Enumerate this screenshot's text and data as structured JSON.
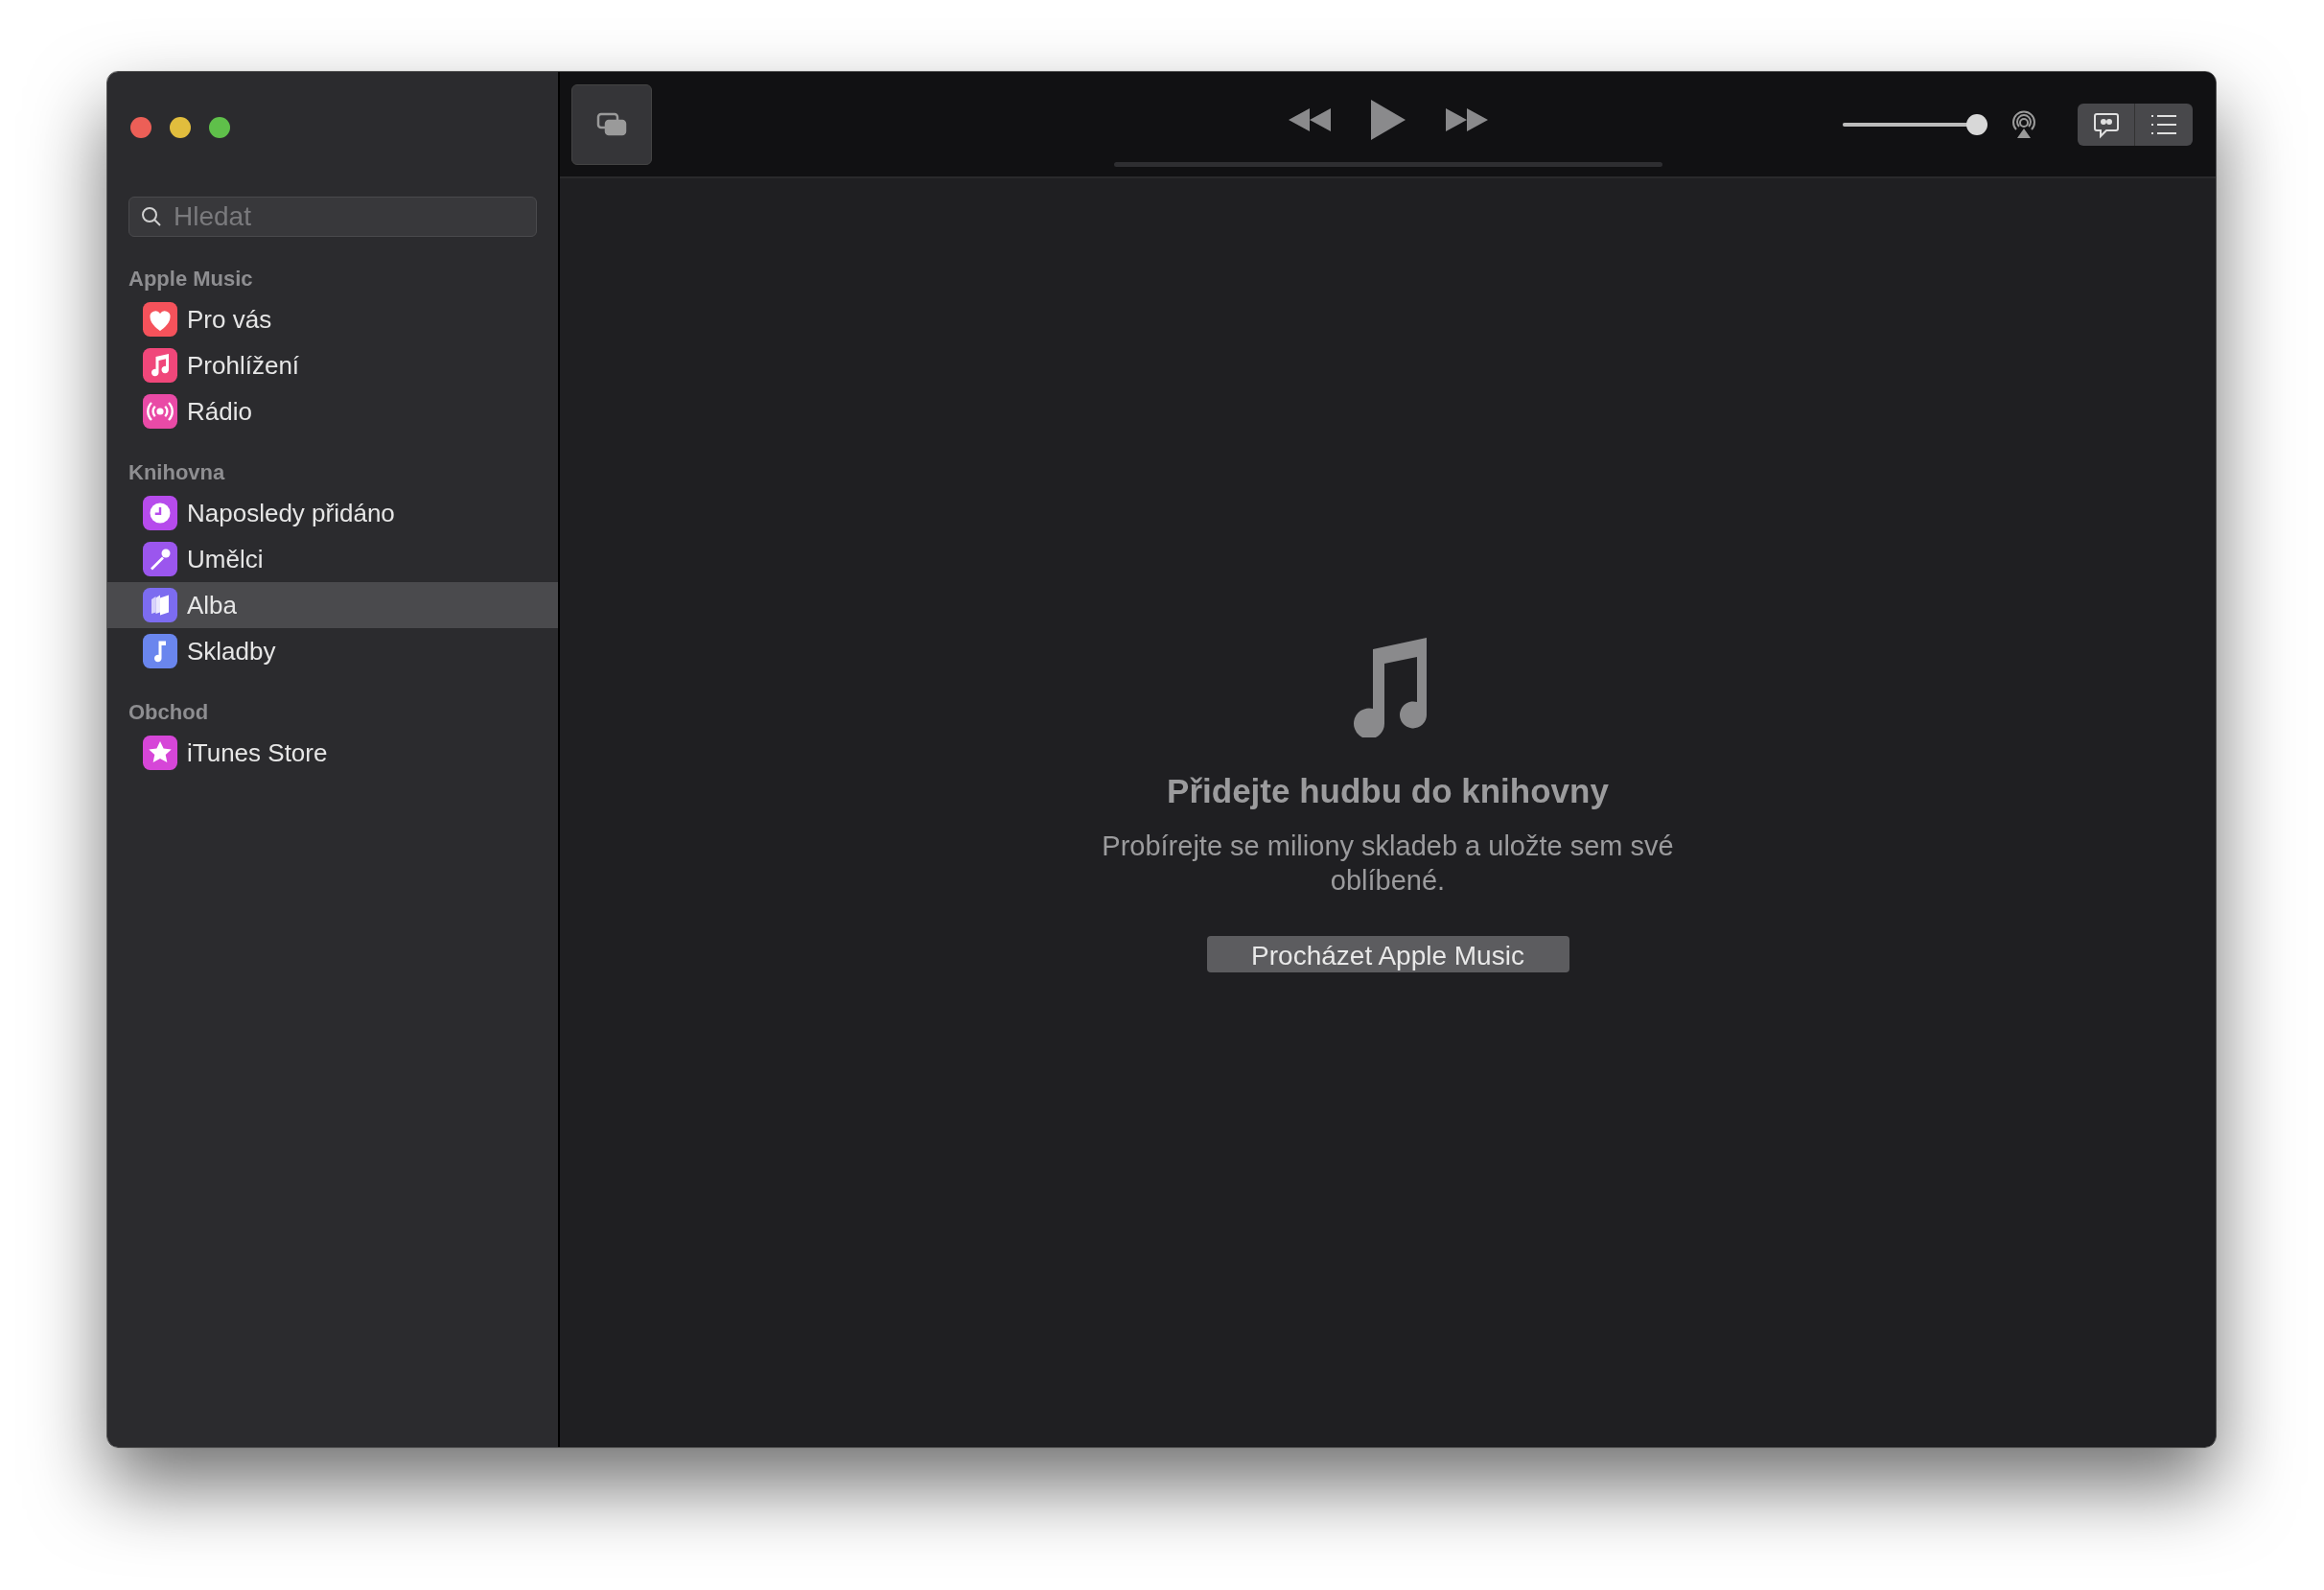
{
  "search": {
    "placeholder": "Hledat"
  },
  "sidebar": {
    "sections": [
      {
        "title": "Apple Music",
        "items": [
          {
            "label": "Pro vás",
            "color": "#f5525b",
            "selected": false
          },
          {
            "label": "Prohlížení",
            "color": "#f0477a",
            "selected": false
          },
          {
            "label": "Rádio",
            "color": "#e94aa6",
            "selected": false
          }
        ]
      },
      {
        "title": "Knihovna",
        "items": [
          {
            "label": "Naposledy přidáno",
            "color": "#b64bec",
            "selected": false
          },
          {
            "label": "Umělci",
            "color": "#9b56ee",
            "selected": false
          },
          {
            "label": "Alba",
            "color": "#7c6cf0",
            "selected": true
          },
          {
            "label": "Skladby",
            "color": "#6a86ee",
            "selected": false
          }
        ]
      },
      {
        "title": "Obchod",
        "items": [
          {
            "label": "iTunes Store",
            "color": "#d646d8",
            "selected": false
          }
        ]
      }
    ]
  },
  "player": {
    "volume": {
      "level": 1
    }
  },
  "empty_state": {
    "title": "Přidejte hudbu do knihovny",
    "text": "Probírejte se miliony skladeb a uložte sem své oblíbené.",
    "button": "Procházet Apple Music"
  }
}
